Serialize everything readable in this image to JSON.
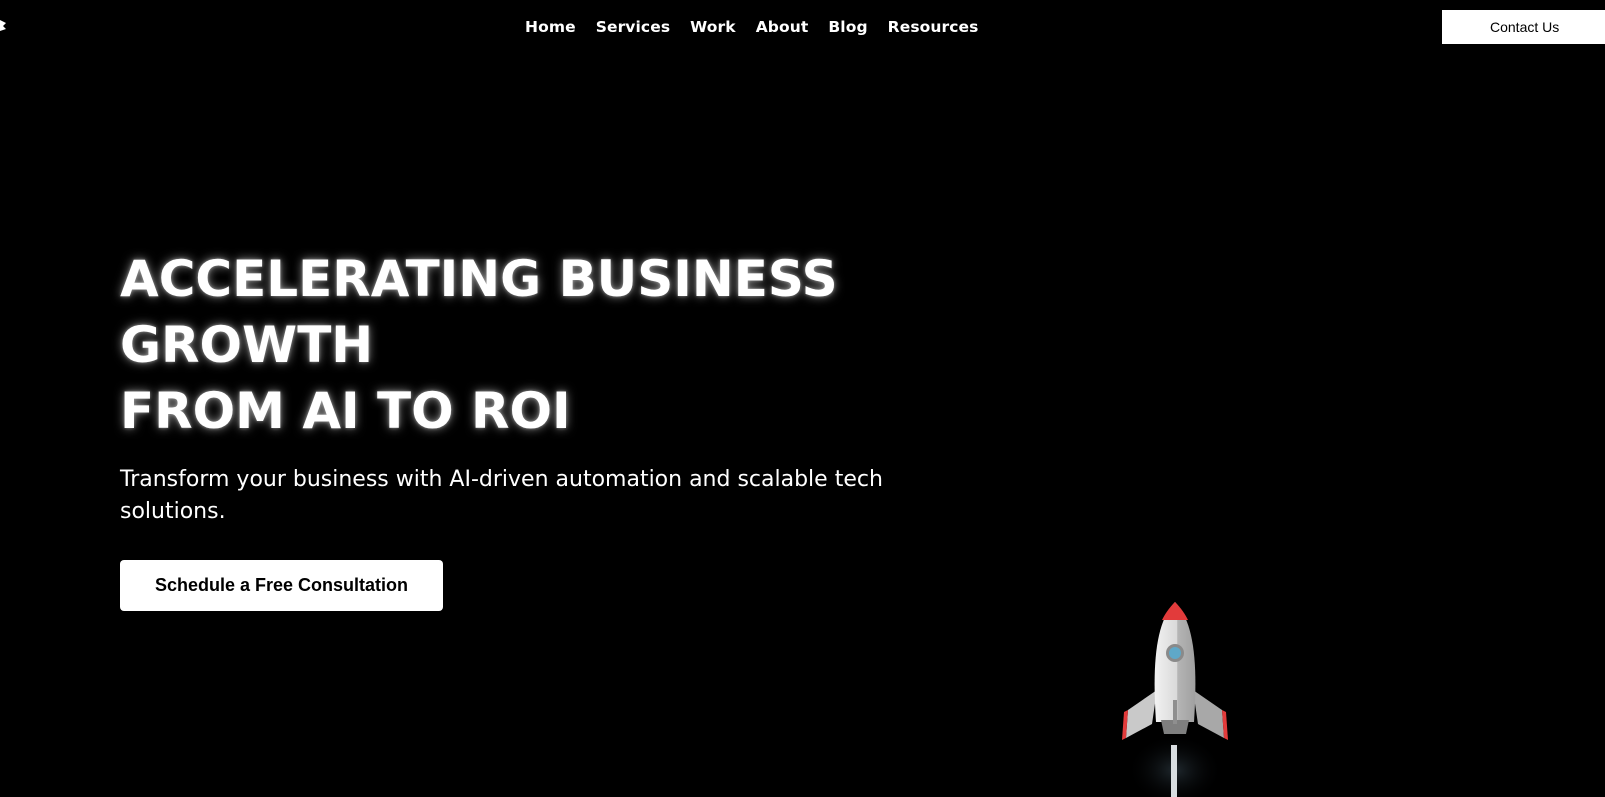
{
  "header": {
    "nav_items": [
      {
        "label": "Home"
      },
      {
        "label": "Services"
      },
      {
        "label": "Work"
      },
      {
        "label": "About"
      },
      {
        "label": "Blog"
      },
      {
        "label": "Resources"
      }
    ],
    "contact_label": "Contact Us"
  },
  "hero": {
    "title_lines": [
      "ACCELERATING BUSINESS",
      "GROWTH",
      "FROM AI TO ROI"
    ],
    "subtitle": "Transform your business with AI-driven automation and scalable tech solutions.",
    "cta_label": "Schedule a Free Consultation"
  },
  "icons": {
    "logo": "logo-icon",
    "rocket": "rocket-icon"
  },
  "colors": {
    "background": "#000000",
    "text": "#ffffff",
    "button_bg": "#ffffff",
    "button_text": "#000000",
    "rocket_accent": "#e23b3b",
    "rocket_window": "#5fa8c8"
  }
}
